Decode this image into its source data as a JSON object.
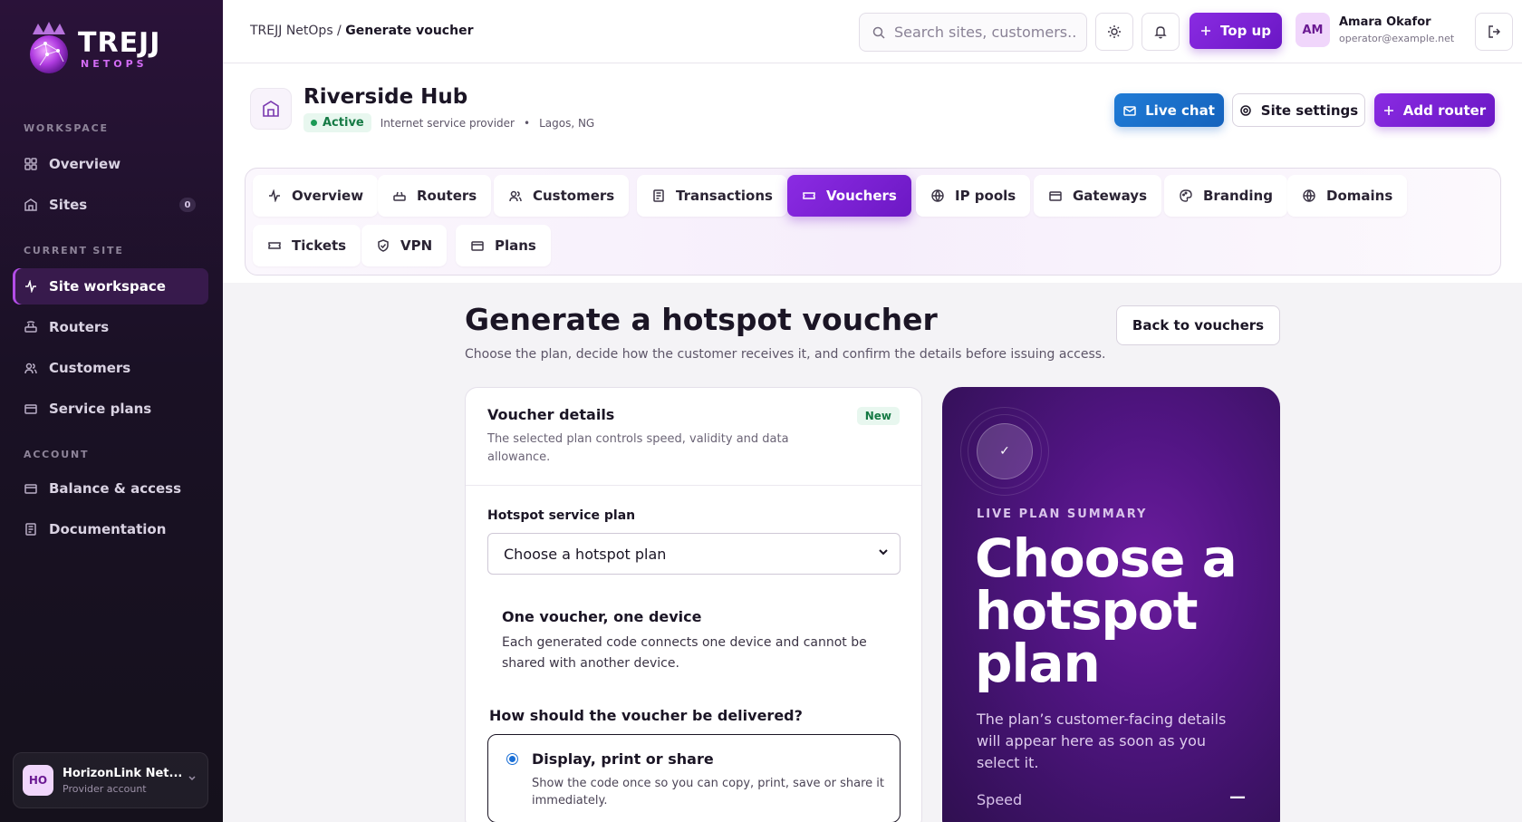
{
  "brand": {
    "name": "TREJJ",
    "sub": "NETOPS"
  },
  "sidebar": {
    "sections": {
      "workspace": "WORKSPACE",
      "current_site": "CURRENT SITE",
      "account": "ACCOUNT"
    },
    "items": [
      {
        "label": "Overview"
      },
      {
        "label": "Sites",
        "count": "0"
      },
      {
        "label": "Site workspace"
      },
      {
        "label": "Routers"
      },
      {
        "label": "Customers"
      },
      {
        "label": "Service plans"
      },
      {
        "label": "Balance & access"
      },
      {
        "label": "Documentation"
      }
    ],
    "account_card": {
      "initials": "HO",
      "name": "HorizonLink Net...",
      "role": "Provider account"
    }
  },
  "topbar": {
    "breadcrumb_root": "TREJJ NetOps",
    "breadcrumb_sep": " / ",
    "breadcrumb_current": "Generate voucher",
    "search_placeholder": "Search sites, customers...",
    "topup_label": "Top up",
    "user": {
      "initials": "AM",
      "name": "Amara Okafor",
      "email": "operator@example.net"
    }
  },
  "site": {
    "name": "Riverside Hub",
    "status": "Active",
    "type": "Internet service provider",
    "location": "Lagos, NG",
    "live_chat_label": "Live chat",
    "settings_label": "Site settings",
    "add_router_label": "Add router"
  },
  "tabs": [
    {
      "label": "Overview"
    },
    {
      "label": "Routers"
    },
    {
      "label": "Customers"
    },
    {
      "label": "Transactions"
    },
    {
      "label": "Vouchers"
    },
    {
      "label": "IP pools"
    },
    {
      "label": "Gateways"
    },
    {
      "label": "Branding"
    },
    {
      "label": "Domains"
    },
    {
      "label": "Tickets"
    },
    {
      "label": "VPN"
    },
    {
      "label": "Plans"
    }
  ],
  "main": {
    "title": "Generate a hotspot voucher",
    "subtitle": "Choose the plan, decide how the customer receives it, and confirm the details before issuing access.",
    "back_label": "Back to vouchers",
    "card": {
      "title": "Voucher details",
      "description": "The selected plan controls speed, validity and data allowance.",
      "badge": "New",
      "plan_label": "Hotspot service plan",
      "plan_value": "Choose a hotspot plan",
      "info_title": "One voucher, one device",
      "info_text": "Each generated code connects one device and cannot be shared with another device.",
      "delivery_label": "How should the voucher be delivered?",
      "delivery_option_title": "Display, print or share",
      "delivery_option_desc": "Show the code once so you can copy, print, save or share it immediately."
    },
    "summary": {
      "check": "✓",
      "label": "LIVE PLAN SUMMARY",
      "title": "Choose a hotspot plan",
      "description": "The plan’s customer-facing details will appear here as soon as you select it.",
      "speed_label": "Speed",
      "speed_value": "—"
    }
  },
  "colors": {
    "accent": "#7a22d6",
    "sidebar_bg": "#1a1125",
    "active_green": "#167a45",
    "chat_blue": "#1f7bd6"
  }
}
